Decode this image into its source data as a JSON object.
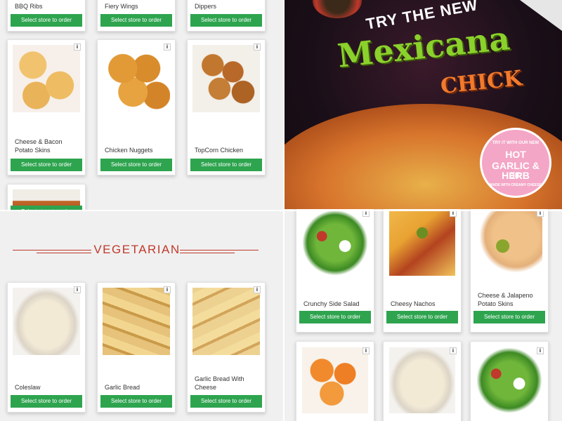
{
  "order_label": "Select store to order",
  "info_glyph": "i",
  "top_left": {
    "row1": [
      {
        "name": "BBQ Ribs"
      },
      {
        "name": "Fiery Wings"
      },
      {
        "name": "Dippers"
      }
    ],
    "row2": [
      {
        "name": "Cheese & Bacon Potato Skins",
        "image": "potato-skins-image"
      },
      {
        "name": "Chicken Nuggets",
        "image": "chicken-nuggets-image"
      },
      {
        "name": "TopCorn Chicken",
        "image": "popcorn-chicken-image"
      }
    ],
    "row3": [
      {
        "name": "",
        "image": "wings-image"
      }
    ]
  },
  "banner": {
    "headline": "TRY THE NEW",
    "product_line1": "Mexicana",
    "product_line2": "CHICK",
    "badge": {
      "top": "TRY IT WITH OUR NEW",
      "line1": "HOT",
      "line2": "GARLIC & HERB",
      "line3": "DIP",
      "bottom": "MADE WITH CREAMY CHEESE"
    },
    "colors": {
      "headline": "#ffffff",
      "product_line1": "#8bd12c",
      "product_line2": "#f27a2c",
      "badge": "#f4a6c6"
    }
  },
  "vegetarian": {
    "section_title": "VEGETARIAN",
    "items": [
      {
        "name": "Coleslaw",
        "image": "coleslaw-image"
      },
      {
        "name": "Garlic Bread",
        "image": "garlic-bread-image"
      },
      {
        "name": "Garlic Bread With Cheese",
        "image": "garlic-bread-cheese-image"
      }
    ],
    "title_color": "#c0392b"
  },
  "bottom_right": {
    "row1": [
      {
        "name": "Crunchy Side Salad",
        "image": "salad-image"
      },
      {
        "name": "Cheesy Nachos",
        "image": "nachos-image"
      },
      {
        "name": "Cheese & Jalapeno Potato Skins",
        "image": "jalapeno-skins-image"
      }
    ],
    "row2": [
      {
        "name": "",
        "image": "jalapeno-poppers-image"
      },
      {
        "name": "",
        "image": "coleslaw-image"
      },
      {
        "name": "",
        "image": "salad-image"
      }
    ]
  },
  "colors": {
    "order_button": "#2ea44f",
    "page_bg": "#f0f0f0"
  }
}
